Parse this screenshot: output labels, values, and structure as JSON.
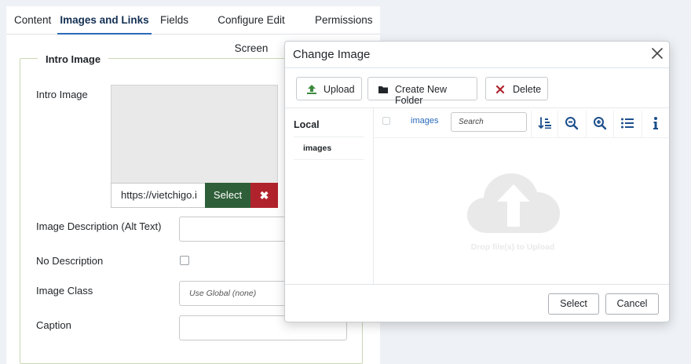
{
  "tabs": [
    "Content",
    "Images and Links",
    "Fields",
    "Configure Edit Screen",
    "Permissions"
  ],
  "active_tab": "Images and Links",
  "fieldset": {
    "legend": "Intro Image",
    "intro_image_label": "Intro Image",
    "url_value": "https://vietchigo.i",
    "select_label": "Select",
    "clear_symbol": "✖",
    "desc_label": "Image Description (Alt Text)",
    "no_desc_label": "No Description",
    "class_label": "Image Class",
    "class_placeholder": "Use Global (none)",
    "caption_label": "Caption"
  },
  "modal": {
    "title": "Change Image",
    "toolbar": {
      "upload": "Upload",
      "new_folder": "Create New Folder",
      "delete": "Delete"
    },
    "sidebar": {
      "heading": "Local",
      "items": [
        "images"
      ]
    },
    "browser": {
      "breadcrumb": "images",
      "search_placeholder": "Search",
      "icons": [
        "sort-icon",
        "zoom-out-icon",
        "zoom-in-icon",
        "list-view-icon",
        "info-icon"
      ],
      "drop_text": "Drop file(s) to Upload"
    },
    "footer": {
      "select": "Select",
      "cancel": "Cancel"
    }
  },
  "colors": {
    "accent": "#2a69b8",
    "success": "#2f5f38",
    "danger": "#b0232d",
    "upload_icon": "#3c8a3e"
  }
}
